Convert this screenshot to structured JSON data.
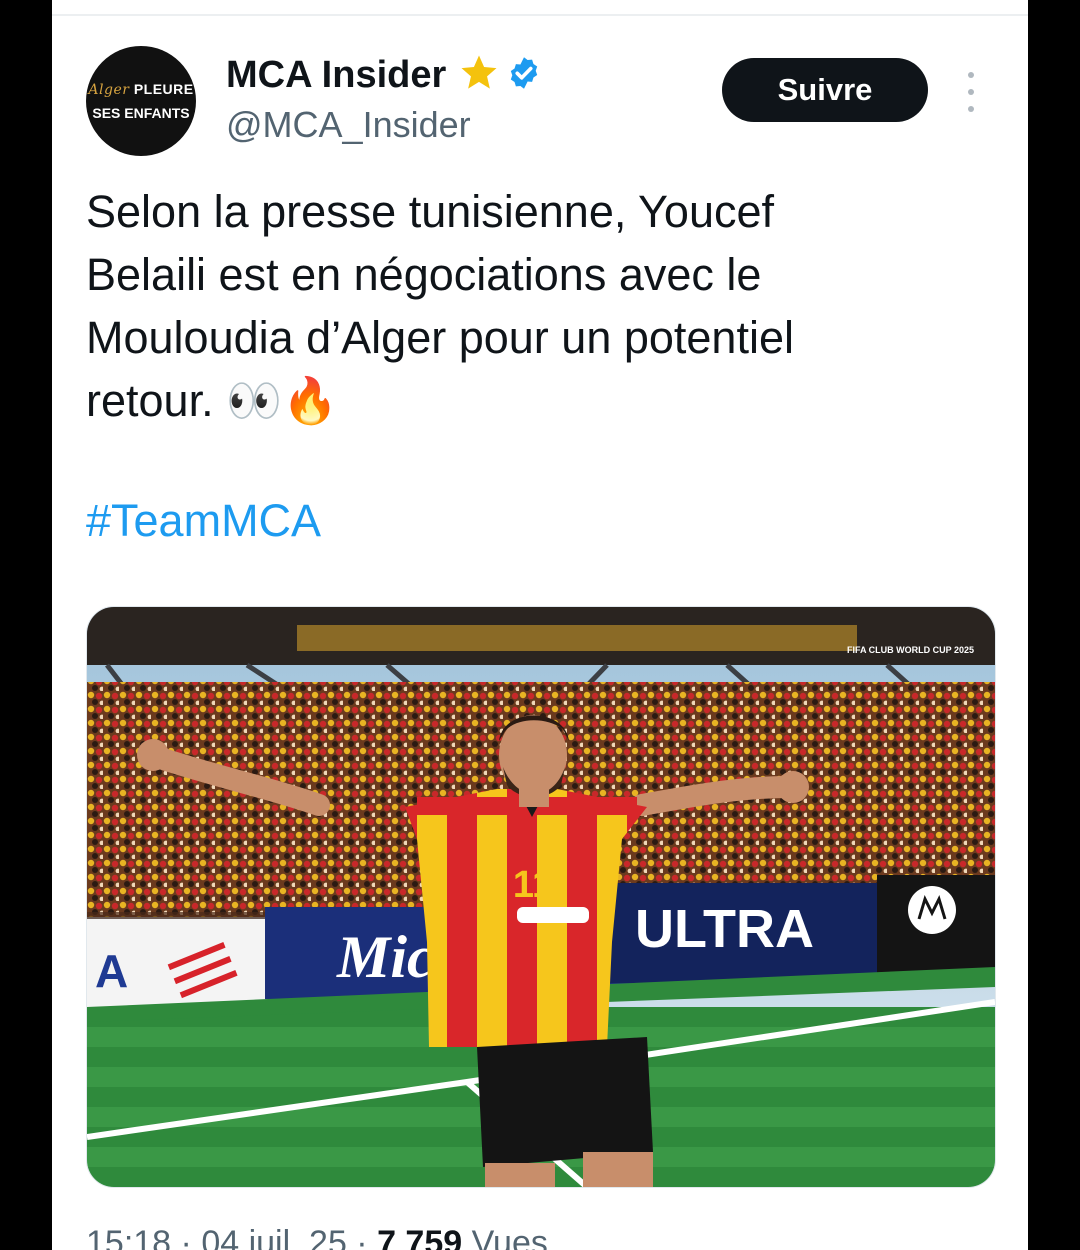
{
  "profile": {
    "avatar_line1_script": "Alger",
    "avatar_line1": "PLEURE",
    "avatar_line2": "SES ENFANTS",
    "name": "MCA Insider",
    "handle": "@MCA_Insider",
    "badge_icons": [
      "star-icon",
      "verified-badge-icon"
    ]
  },
  "actions": {
    "follow_label": "Suivre",
    "more_icon": "vertical-dots-icon"
  },
  "tweet": {
    "text": "Selon la presse tunisienne, Youcef\nBelaili est en négociations avec le\nMouloudia d’Alger pour un potentiel\nretour. 👀🔥",
    "hashtag": "#TeamMCA"
  },
  "photo": {
    "jersey_number": "11",
    "board_ultra": "ULTRA",
    "board_mic": "Mic",
    "board_a": "A",
    "banner_text": "FIFA CLUB WORLD CUP 2025"
  },
  "meta": {
    "time": "15:18",
    "date": "04 juil. 25",
    "views": "7 759",
    "views_label": "Vues"
  },
  "colors": {
    "accent": "#1d9bf0",
    "text": "#0f1419",
    "muted": "#536471",
    "star": "#f4c20d"
  }
}
